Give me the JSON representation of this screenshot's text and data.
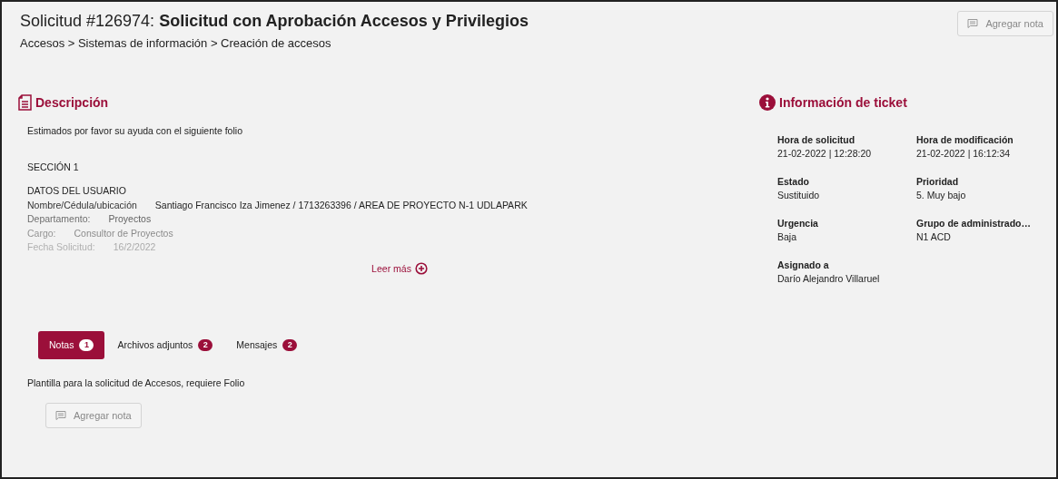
{
  "header": {
    "request_label": "Solicitud #126974:",
    "title": "Solicitud con Aprobación Accesos y Privilegios",
    "breadcrumb": "Accesos > Sistemas de información > Creación de accesos",
    "add_note_button": "Agregar nota"
  },
  "description": {
    "heading": "Descripción",
    "lines": [
      {
        "kind": "text",
        "text": "Estimados por favor su ayuda con el siguiente folio"
      },
      {
        "kind": "heading",
        "text": "SECCIÓN 1"
      },
      {
        "kind": "heading",
        "text": "DATOS DEL USUARIO"
      },
      {
        "kind": "field",
        "label": "Nombre/Cédula/ubicación",
        "value": "Santiago Francisco Iza Jimenez / 1713263396 / AREA DE PROYECTO N-1 UDLAPARK"
      },
      {
        "kind": "field",
        "label": "Departamento:",
        "value": "Proyectos"
      },
      {
        "kind": "field",
        "label": "Cargo:",
        "value": "Consultor de Proyectos"
      },
      {
        "kind": "field",
        "label": "Fecha Solicitud:",
        "value": "16/2/2022"
      }
    ],
    "read_more": "Leer más"
  },
  "ticket_info": {
    "heading": "Información de ticket",
    "fields": [
      {
        "label": "Hora de solicitud",
        "value": "21-02-2022 | 12:28:20"
      },
      {
        "label": "Hora de modificación",
        "value": "21-02-2022 | 16:12:34"
      },
      {
        "label": "Estado",
        "value": "Sustituido"
      },
      {
        "label": "Prioridad",
        "value": "5. Muy bajo"
      },
      {
        "label": "Urgencia",
        "value": "Baja"
      },
      {
        "label": "Grupo de administrado…",
        "value": "N1 ACD"
      },
      {
        "label": "Asignado a",
        "value": "Darío Alejandro Villaruel"
      }
    ]
  },
  "tabs": [
    {
      "label": "Notas",
      "count": "1",
      "selected": true
    },
    {
      "label": "Archivos adjuntos",
      "count": "2",
      "selected": false
    },
    {
      "label": "Mensajes",
      "count": "2",
      "selected": false
    }
  ],
  "notes": {
    "text": "Plantilla para la solicitud de Accesos, requiere Folio",
    "add_note_button": "Agregar nota"
  }
}
